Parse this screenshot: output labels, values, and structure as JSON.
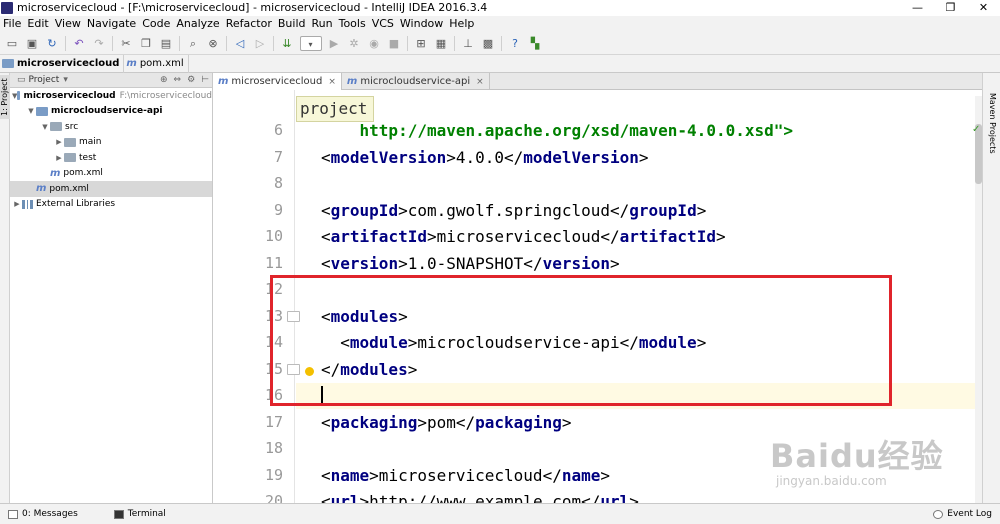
{
  "window": {
    "title": "microservicecloud - [F:\\microservicecloud] - microservicecloud - IntelliJ IDEA 2016.3.4",
    "controls": [
      "—",
      "❐",
      "✕"
    ]
  },
  "menu": [
    "File",
    "Edit",
    "View",
    "Navigate",
    "Code",
    "Analyze",
    "Refactor",
    "Build",
    "Run",
    "Tools",
    "VCS",
    "Window",
    "Help"
  ],
  "breadcrumb": {
    "project": "microservicecloud",
    "file": "pom.xml"
  },
  "side_tabs": {
    "left": "1: Project",
    "right": "Maven Projects"
  },
  "project_panel": {
    "header": "Project",
    "tree": [
      {
        "label": "microservicecloud",
        "path": "F:\\microservicecloud",
        "icon": "module-folder-icon",
        "level": 0,
        "expanded": true,
        "bold": true
      },
      {
        "label": "microcloudservice-api",
        "path": "",
        "icon": "module-folder-icon",
        "level": 1,
        "expanded": true,
        "bold": true
      },
      {
        "label": "src",
        "path": "",
        "icon": "folder-icon",
        "level": 2,
        "expanded": true,
        "bold": false
      },
      {
        "label": "main",
        "path": "",
        "icon": "folder-icon",
        "level": 3,
        "expanded": false,
        "bold": false
      },
      {
        "label": "test",
        "path": "",
        "icon": "folder-icon",
        "level": 3,
        "expanded": false,
        "bold": false
      },
      {
        "label": "pom.xml",
        "path": "",
        "icon": "maven-file-icon",
        "level": 2,
        "leaf": true,
        "bold": false
      },
      {
        "label": "pom.xml",
        "path": "",
        "icon": "maven-file-icon",
        "level": 1,
        "leaf": true,
        "bold": false,
        "selected": true
      },
      {
        "label": "External Libraries",
        "path": "",
        "icon": "library-icon",
        "level": 0,
        "expanded": false,
        "bold": false
      }
    ]
  },
  "editor": {
    "tabs": [
      {
        "label": "microservicecloud",
        "active": true
      },
      {
        "label": "microcloudservice-api",
        "active": false
      }
    ],
    "tooltip": "project",
    "lines": [
      {
        "num": "6",
        "parts": [
          [
            "str",
            "    http://maven.apache.org/xsd/maven-4.0.0.xsd\">"
          ]
        ]
      },
      {
        "num": "7",
        "parts": [
          [
            "p",
            "<"
          ],
          [
            "tg",
            "modelVersion"
          ],
          [
            "p",
            ">4.0.0</"
          ],
          [
            "tg",
            "modelVersion"
          ],
          [
            "p",
            ">"
          ]
        ]
      },
      {
        "num": "8",
        "parts": []
      },
      {
        "num": "9",
        "parts": [
          [
            "p",
            "<"
          ],
          [
            "tg",
            "groupId"
          ],
          [
            "p",
            ">com.gwolf.springcloud</"
          ],
          [
            "tg",
            "groupId"
          ],
          [
            "p",
            ">"
          ]
        ]
      },
      {
        "num": "10",
        "parts": [
          [
            "p",
            "<"
          ],
          [
            "tg",
            "artifactId"
          ],
          [
            "p",
            ">microservicecloud</"
          ],
          [
            "tg",
            "artifactId"
          ],
          [
            "p",
            ">"
          ]
        ]
      },
      {
        "num": "11",
        "parts": [
          [
            "p",
            "<"
          ],
          [
            "tg",
            "version"
          ],
          [
            "p",
            ">1.0-SNAPSHOT</"
          ],
          [
            "tg",
            "version"
          ],
          [
            "p",
            ">"
          ]
        ]
      },
      {
        "num": "12",
        "parts": []
      },
      {
        "num": "13",
        "parts": [
          [
            "p",
            "<"
          ],
          [
            "tg",
            "modules"
          ],
          [
            "p",
            ">"
          ]
        ]
      },
      {
        "num": "14",
        "parts": [
          [
            "p",
            "  <"
          ],
          [
            "tg",
            "module"
          ],
          [
            "p",
            ">microcloudservice-api</"
          ],
          [
            "tg",
            "module"
          ],
          [
            "p",
            ">"
          ]
        ]
      },
      {
        "num": "15",
        "parts": [
          [
            "p",
            "</"
          ],
          [
            "tg",
            "modules"
          ],
          [
            "p",
            ">"
          ]
        ]
      },
      {
        "num": "16",
        "parts": [],
        "current": true
      },
      {
        "num": "17",
        "parts": [
          [
            "p",
            "<"
          ],
          [
            "tg",
            "packaging"
          ],
          [
            "p",
            ">pom</"
          ],
          [
            "tg",
            "packaging"
          ],
          [
            "p",
            ">"
          ]
        ]
      },
      {
        "num": "18",
        "parts": []
      },
      {
        "num": "19",
        "parts": [
          [
            "p",
            "<"
          ],
          [
            "tg",
            "name"
          ],
          [
            "p",
            ">microservicecloud</"
          ],
          [
            "tg",
            "name"
          ],
          [
            "p",
            ">"
          ]
        ]
      },
      {
        "num": "20",
        "parts": [
          [
            "p",
            "<"
          ],
          [
            "tg",
            "url"
          ],
          [
            "p",
            ">http://www.example.com</"
          ],
          [
            "tg",
            "url"
          ],
          [
            "p",
            ">"
          ]
        ]
      }
    ]
  },
  "statusbar": {
    "messages": "0: Messages",
    "terminal": "Terminal",
    "event_log": "Event Log"
  },
  "watermark": {
    "brand": "Baidu经验",
    "url": "jingyan.baidu.com"
  },
  "colors": {
    "tag": "#000080",
    "string": "#008000",
    "highlight_box": "#e0242b",
    "current_line": "#fffae3"
  }
}
